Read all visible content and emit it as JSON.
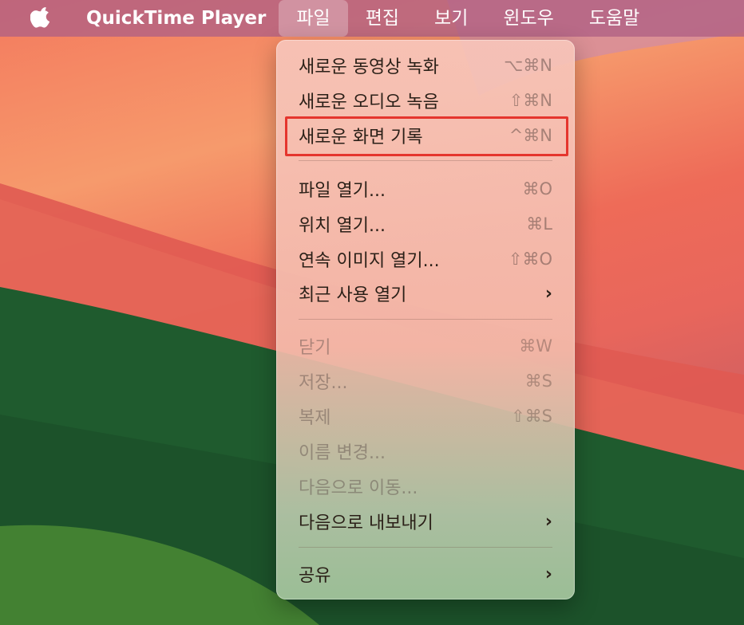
{
  "menubar": {
    "app_name": "QuickTime Player",
    "items": [
      "파일",
      "편집",
      "보기",
      "윈도우",
      "도움말"
    ]
  },
  "file_menu": {
    "items": [
      {
        "label": "새로운 동영상 녹화",
        "shortcut": "⌥⌘N"
      },
      {
        "label": "새로운 오디오 녹음",
        "shortcut": "⇧⌘N"
      },
      {
        "label": "새로운 화면 기록",
        "shortcut": "^⌘N"
      },
      {
        "label": "파일 열기...",
        "shortcut": "⌘O"
      },
      {
        "label": "위치 열기...",
        "shortcut": "⌘L"
      },
      {
        "label": "연속 이미지 열기...",
        "shortcut": "⇧⌘O"
      },
      {
        "label": "최근 사용 열기",
        "submenu": true
      },
      {
        "label": "닫기",
        "shortcut": "⌘W",
        "disabled": true
      },
      {
        "label": "저장...",
        "shortcut": "⌘S",
        "disabled": true
      },
      {
        "label": "복제",
        "shortcut": "⇧⌘S",
        "disabled": true
      },
      {
        "label": "이름 변경...",
        "disabled": true
      },
      {
        "label": "다음으로 이동...",
        "disabled": true
      },
      {
        "label": "다음으로 내보내기",
        "submenu": true
      },
      {
        "label": "공유",
        "submenu": true
      }
    ]
  },
  "colors": {
    "highlight_border": "#e5352d"
  }
}
